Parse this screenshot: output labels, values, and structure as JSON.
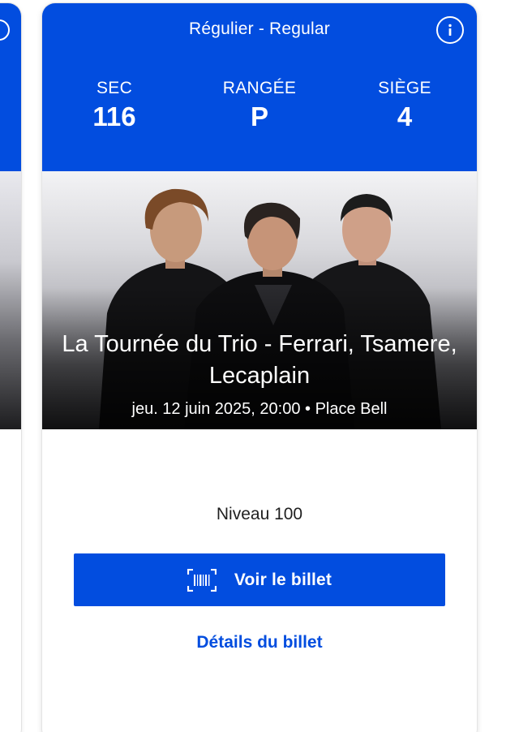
{
  "ticket": {
    "type_label": "Régulier - Regular",
    "section": {
      "label": "SEC",
      "value": "116"
    },
    "row": {
      "label": "RANGÉE",
      "value": "P"
    },
    "seat": {
      "label": "SIÈGE",
      "value": "4"
    },
    "event_title": "La Tournée du Trio - Ferrari, Tsamere, Lecaplain",
    "event_meta": "jeu. 12 juin 2025, 20:00 • Place Bell",
    "level": "Niveau 100",
    "view_button_label": "Voir le billet",
    "details_link_label": "Détails du billet"
  },
  "icons": {
    "info": "info-icon",
    "barcode": "barcode-icon"
  },
  "colors": {
    "brand_blue": "#024ddf",
    "text_dark": "#1f1f1f",
    "white": "#ffffff"
  }
}
